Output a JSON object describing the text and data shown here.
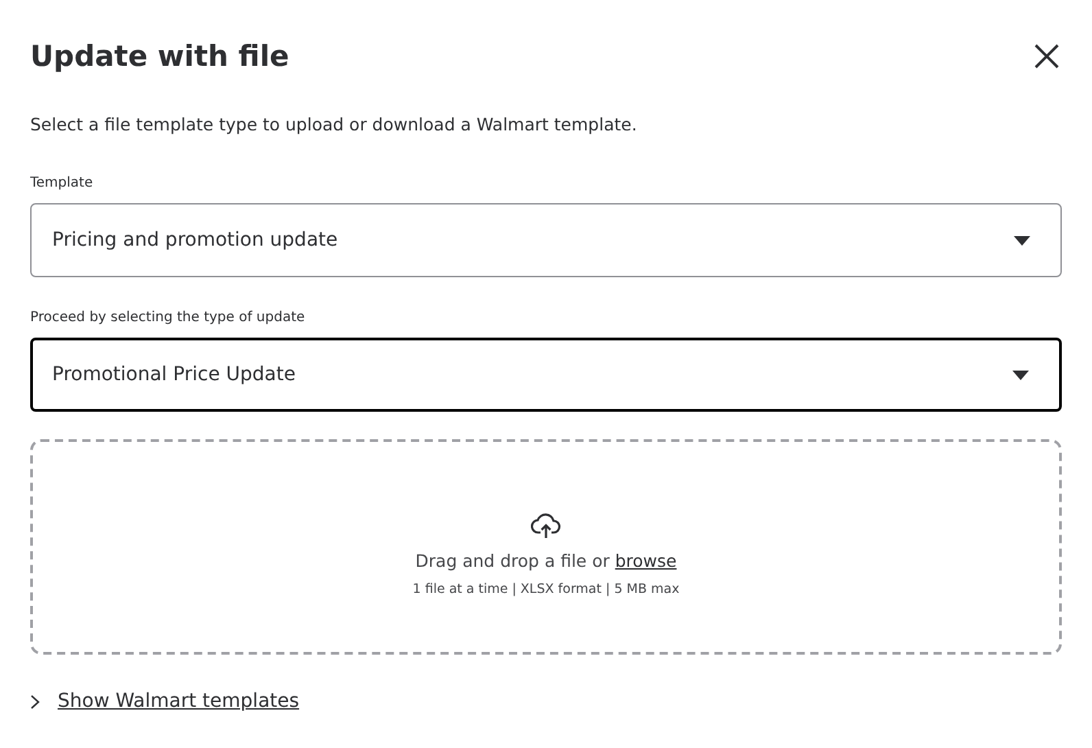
{
  "dialog": {
    "title": "Update with file",
    "description": "Select a file template type to upload or download a Walmart template.",
    "fields": [
      {
        "label": "Template",
        "value": "Pricing and promotion update",
        "focused": false
      },
      {
        "label": "Proceed by selecting the type of update",
        "value": "Promotional Price Update",
        "focused": true
      }
    ],
    "dropzone": {
      "prompt": "Drag and drop a file or",
      "link": "browse",
      "info": "1 file at a time | XLSX format | 5 MB max"
    },
    "templates_toggle": {
      "label": "Show Walmart templates",
      "expanded": false
    }
  }
}
